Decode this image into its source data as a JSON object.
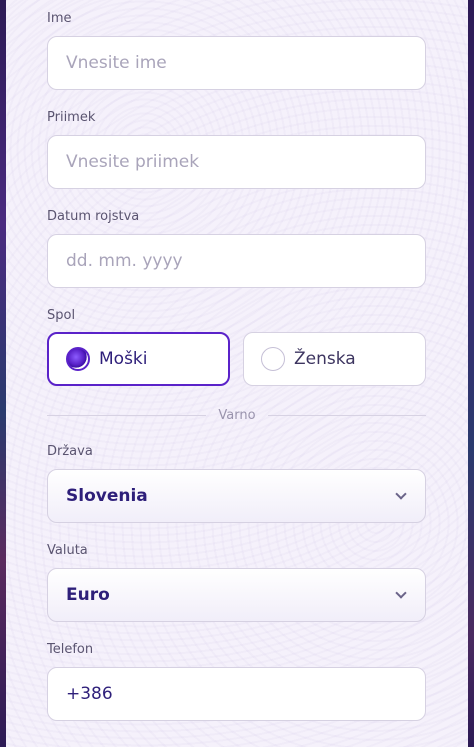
{
  "form": {
    "first_name": {
      "label": "Ime",
      "placeholder": "Vnesite ime"
    },
    "last_name": {
      "label": "Priimek",
      "placeholder": "Vnesite priimek"
    },
    "birth_date": {
      "label": "Datum rojstva",
      "placeholder": "dd. mm. yyyy"
    },
    "gender": {
      "label": "Spol",
      "options": [
        {
          "label": "Moški",
          "selected": true
        },
        {
          "label": "Ženska",
          "selected": false
        }
      ]
    },
    "divider_text": "Varno",
    "country": {
      "label": "Država",
      "value": "Slovenia"
    },
    "currency": {
      "label": "Valuta",
      "value": "Euro"
    },
    "phone": {
      "label": "Telefon",
      "value": "+386"
    }
  },
  "colors": {
    "accent": "#5a22c9",
    "value_text": "#2e1f7a",
    "label_text": "#5a5470",
    "panel_bg": "#f5f1fb"
  }
}
